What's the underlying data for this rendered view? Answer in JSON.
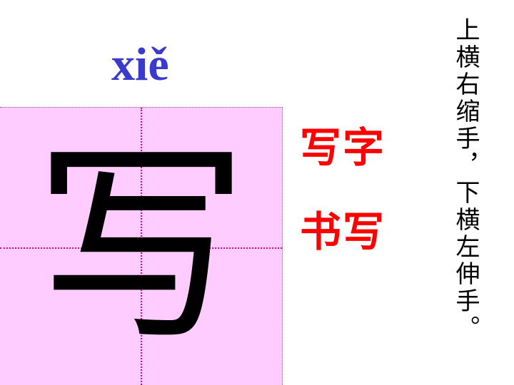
{
  "rhyme": {
    "text": "上横右缩手，下横左伸手。"
  },
  "pinyin": "xiě",
  "character": {
    "glyph": "写"
  },
  "words": [
    "写字",
    "书写"
  ],
  "colors": {
    "pinyin": "#3a3acc",
    "words": "#ff0000",
    "grid_background": "#ffccff",
    "grid_guides": "#e6007e"
  }
}
